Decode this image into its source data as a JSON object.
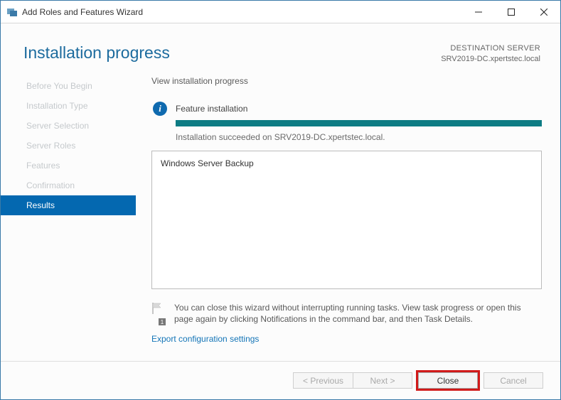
{
  "window": {
    "title": "Add Roles and Features Wizard"
  },
  "header": {
    "title": "Installation progress",
    "destination_label": "DESTINATION SERVER",
    "destination_value": "SRV2019-DC.xpertstec.local"
  },
  "sidebar": {
    "items": [
      {
        "label": "Before You Begin",
        "active": false
      },
      {
        "label": "Installation Type",
        "active": false
      },
      {
        "label": "Server Selection",
        "active": false
      },
      {
        "label": "Server Roles",
        "active": false
      },
      {
        "label": "Features",
        "active": false
      },
      {
        "label": "Confirmation",
        "active": false
      },
      {
        "label": "Results",
        "active": true
      }
    ]
  },
  "content": {
    "view_label": "View installation progress",
    "feature_install_label": "Feature installation",
    "status_text": "Installation succeeded on SRV2019-DC.xpertstec.local.",
    "features": [
      "Windows Server Backup"
    ],
    "note_text": "You can close this wizard without interrupting running tasks. View task progress or open this page again by clicking Notifications in the command bar, and then Task Details.",
    "flag_badge": "1",
    "export_link": "Export configuration settings"
  },
  "buttons": {
    "previous": "< Previous",
    "next": "Next >",
    "close": "Close",
    "cancel": "Cancel"
  }
}
